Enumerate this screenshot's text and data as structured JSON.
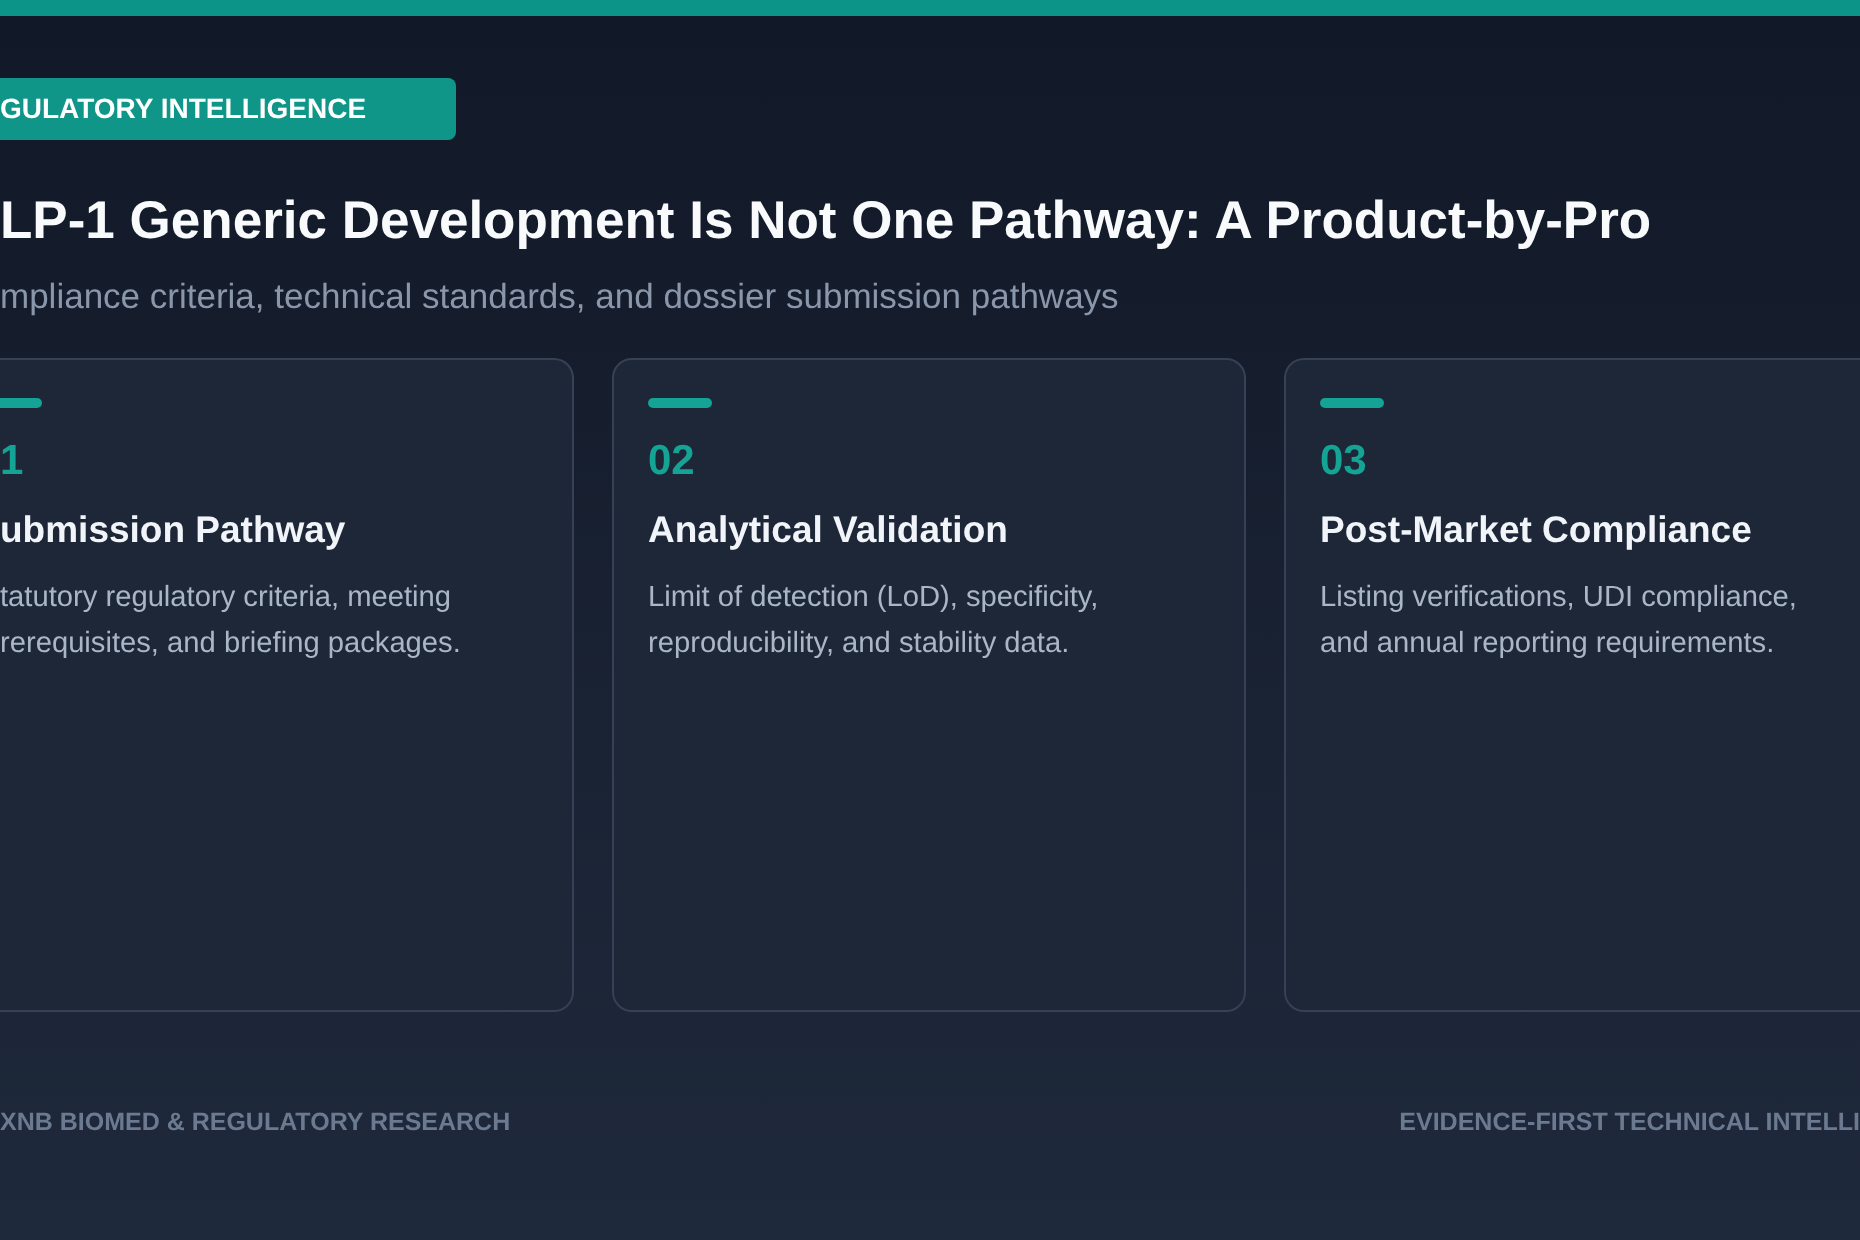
{
  "badge": "GULATORY INTELLIGENCE",
  "title": "LP-1 Generic Development Is Not One Pathway: A Product-by-Pro",
  "subtitle": "mpliance criteria, technical standards, and dossier submission pathways",
  "cards": [
    {
      "number": "1",
      "title": "ubmission Pathway",
      "description": "tatutory regulatory criteria, meeting rerequisites, and briefing packages."
    },
    {
      "number": "02",
      "title": "Analytical Validation",
      "description": "Limit of detection (LoD), specificity, reproducibility, and stability data."
    },
    {
      "number": "03",
      "title": "Post-Market Compliance",
      "description": "Listing verifications, UDI compliance, and annual reporting requirements."
    }
  ],
  "footer": {
    "left": "XNB BIOMED & REGULATORY RESEARCH",
    "right": "EVIDENCE-FIRST TECHNICAL INTELLI"
  }
}
